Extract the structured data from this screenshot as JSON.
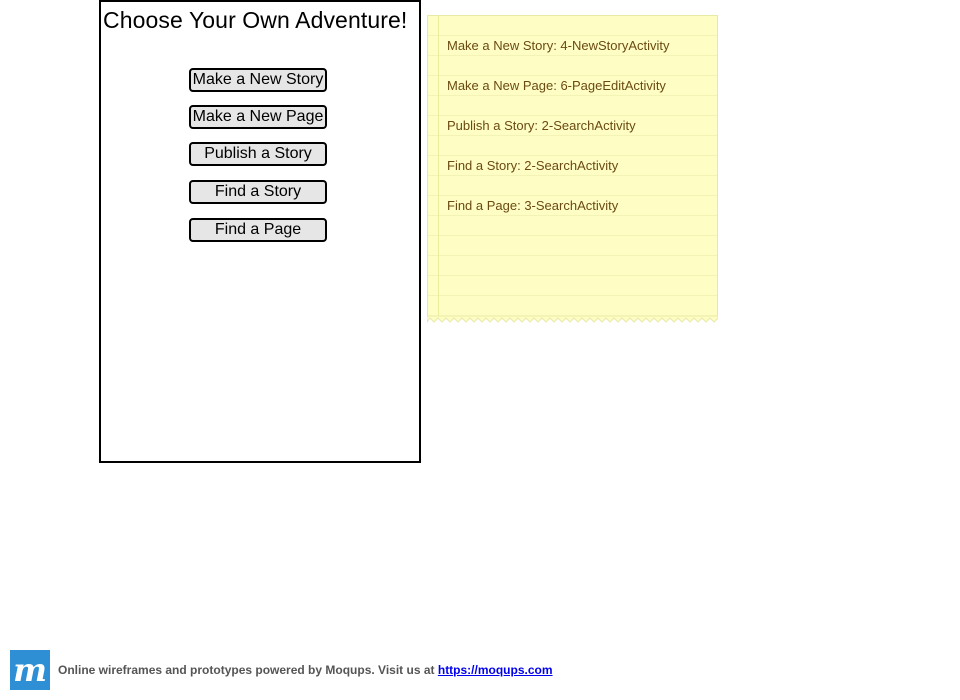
{
  "phone": {
    "title": "Choose Your Own Adventure!",
    "buttons": [
      {
        "label": "Make a New Story"
      },
      {
        "label": "Make a New Page"
      },
      {
        "label": "Publish a Story"
      },
      {
        "label": "Find a Story"
      },
      {
        "label": "Find a Page"
      }
    ]
  },
  "note": {
    "lines": [
      "Make a New Story: 4-NewStoryActivity",
      "Make a New Page: 6-PageEditActivity",
      "Publish a Story: 2-SearchActivity",
      "Find a Story: 2-SearchActivity",
      "Find a Page: 3-SearchActivity"
    ],
    "color": "#fefec4",
    "text_color": "#6b4a12"
  },
  "footer": {
    "logo_letter": "m",
    "text": "Online wireframes and prototypes powered by Moqups. Visit us at ",
    "link_text": "https://moqups.com",
    "logo_color": "#2e8fd5"
  }
}
